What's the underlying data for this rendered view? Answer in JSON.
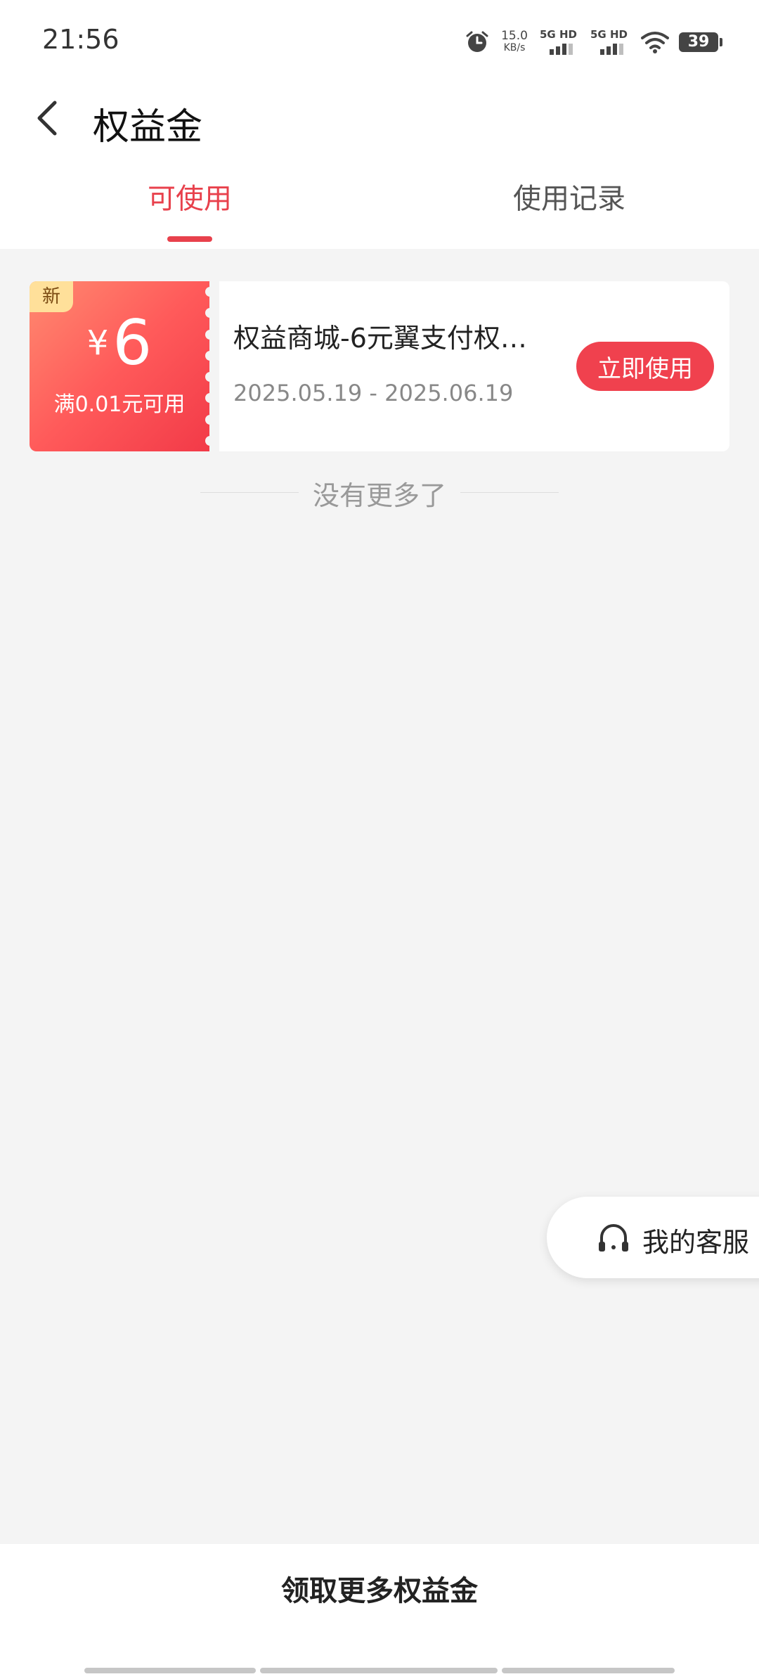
{
  "status_bar": {
    "time": "21:56",
    "speed_value": "15.0",
    "speed_unit": "KB/s",
    "network1": "5G HD",
    "network2": "5G HD",
    "battery": "39"
  },
  "header": {
    "title": "权益金"
  },
  "tabs": [
    {
      "label": "可使用",
      "active": true
    },
    {
      "label": "使用记录",
      "active": false
    }
  ],
  "coupon": {
    "badge": "新",
    "currency": "¥",
    "amount": "6",
    "condition": "满0.01元可用",
    "title": "权益商城-6元翼支付权…",
    "date_range": "2025.05.19 - 2025.06.19",
    "use_button": "立即使用"
  },
  "list_end_text": "没有更多了",
  "service": {
    "label": "我的客服"
  },
  "bottom": {
    "more_button": "领取更多权益金"
  },
  "colors": {
    "accent": "#e8414c",
    "button": "#f0414e",
    "badge": "#ffe09a"
  }
}
